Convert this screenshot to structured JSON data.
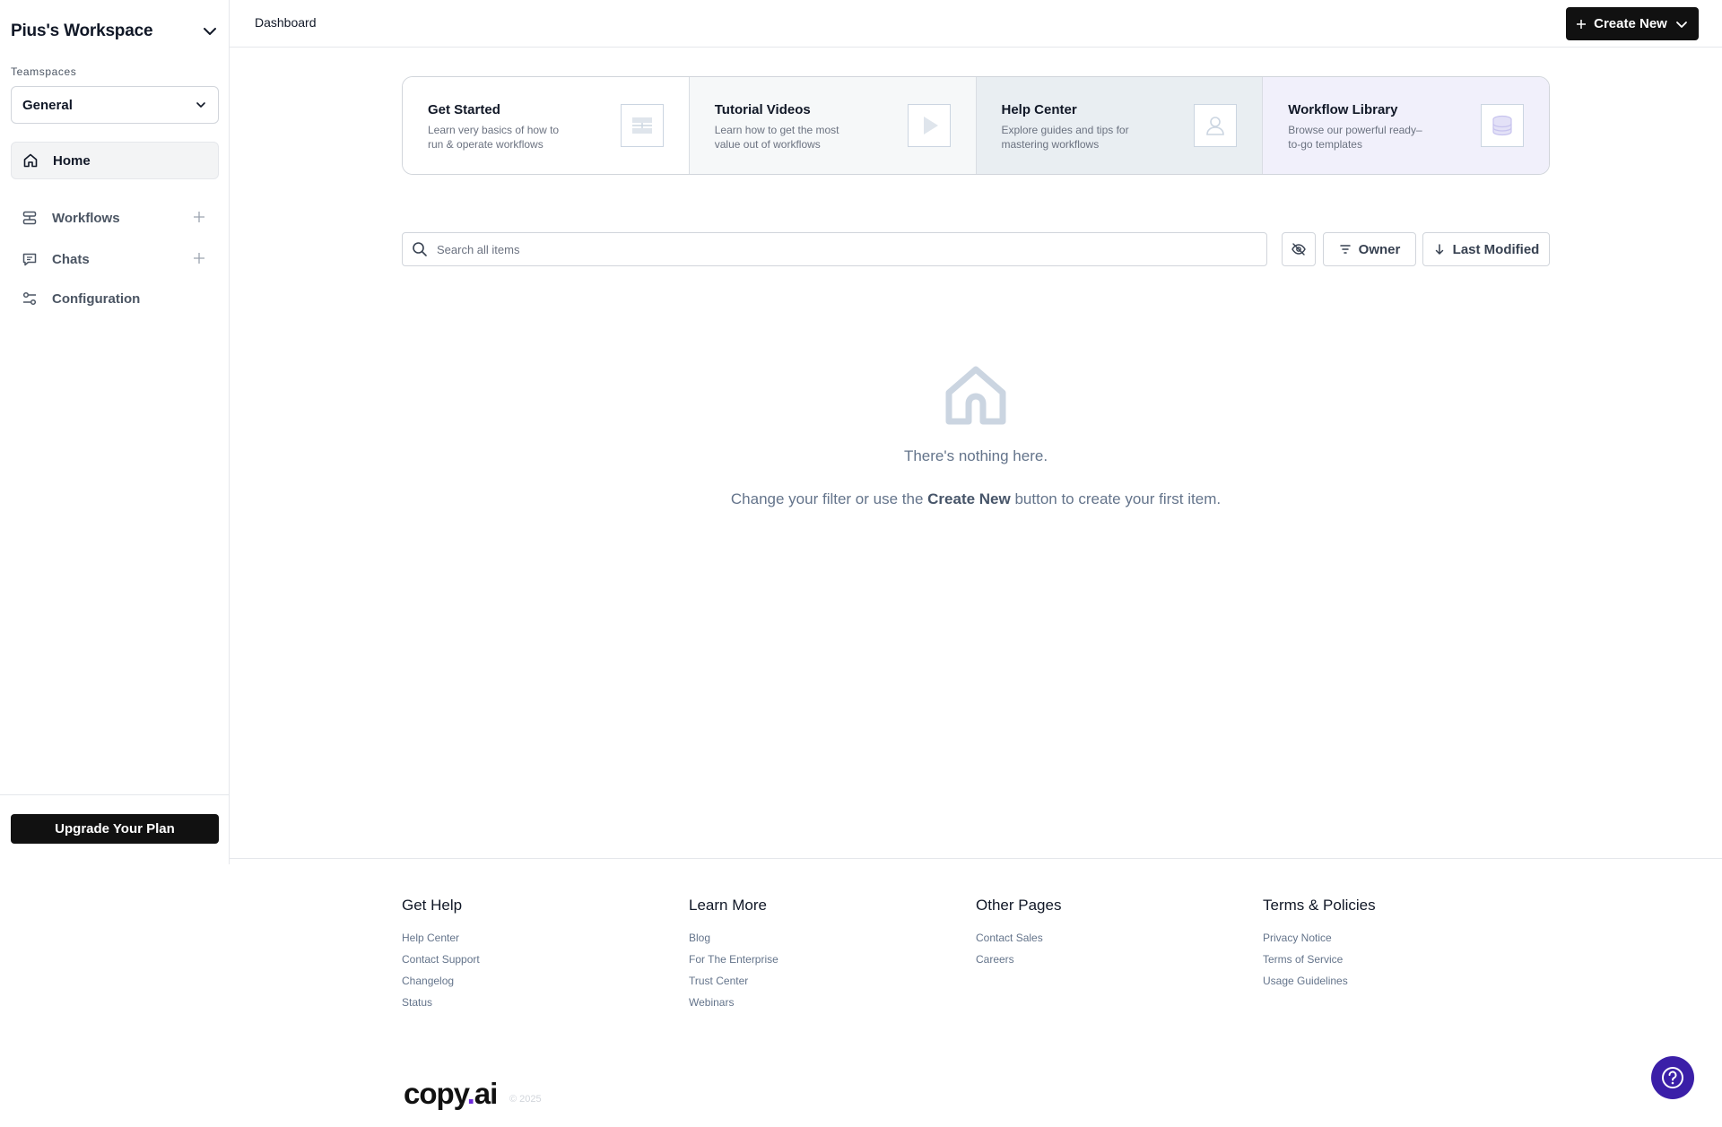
{
  "sidebar": {
    "workspace_title": "Pius's Workspace",
    "teamspaces_label": "Teamspaces",
    "teamspace_selected": "General",
    "nav": [
      {
        "label": "Home",
        "icon": "home-icon"
      },
      {
        "label": "Workflows",
        "icon": "workflows-icon"
      },
      {
        "label": "Chats",
        "icon": "chat-icon"
      },
      {
        "label": "Configuration",
        "icon": "sliders-icon"
      }
    ],
    "upgrade_label": "Upgrade Your Plan"
  },
  "topbar": {
    "breadcrumb": "Dashboard",
    "create_label": "Create New"
  },
  "cards": [
    {
      "title": "Get Started",
      "desc": "Learn very basics of how to run & operate workflows"
    },
    {
      "title": "Tutorial Videos",
      "desc": "Learn how to get the most value out of workflows"
    },
    {
      "title": "Help Center",
      "desc": "Explore guides and tips for mastering workflows"
    },
    {
      "title": "Workflow Library",
      "desc": "Browse our powerful ready–to-go templates"
    }
  ],
  "search": {
    "placeholder": "Search all items"
  },
  "filters": {
    "owner_label": "Owner",
    "sort_label": "Last Modified"
  },
  "empty": {
    "title": "There's nothing here.",
    "desc_before": "Change your filter or use the ",
    "desc_bold": "Create New",
    "desc_after": " button to create your first item."
  },
  "footer": {
    "columns": [
      {
        "title": "Get Help",
        "links": [
          "Help Center",
          "Contact Support",
          "Changelog",
          "Status"
        ]
      },
      {
        "title": "Learn More",
        "links": [
          "Blog",
          "For The Enterprise",
          "Trust Center",
          "Webinars"
        ]
      },
      {
        "title": "Other Pages",
        "links": [
          "Contact Sales",
          "Careers"
        ]
      },
      {
        "title": "Terms & Policies",
        "links": [
          "Privacy Notice",
          "Terms of Service",
          "Usage Guidelines"
        ]
      }
    ],
    "logo_text": "copy",
    "logo_dot": ".",
    "logo_suffix": "ai",
    "copyright": "© 2025"
  },
  "colors": {
    "accent": "#3b1fa8",
    "primary_button": "#111111"
  }
}
